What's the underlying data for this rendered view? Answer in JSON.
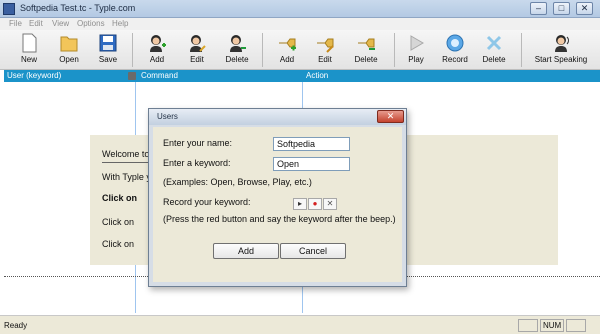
{
  "window": {
    "title": "Softpedia Test.tc - Typle.com",
    "minimize": "–",
    "maximize": "□",
    "close": "✕"
  },
  "menu": [
    "File",
    "Edit",
    "View",
    "Options",
    "Help"
  ],
  "toolbar": {
    "new": "New",
    "open": "Open",
    "save": "Save",
    "user_add": "Add",
    "user_edit": "Edit",
    "user_delete": "Delete",
    "cmd_add": "Add",
    "cmd_edit": "Edit",
    "cmd_delete": "Delete",
    "play": "Play",
    "record": "Record",
    "action_delete": "Delete",
    "start_speaking": "Start Speaking"
  },
  "columns": {
    "user": "User (keyword)",
    "command": "Command",
    "action": "Action"
  },
  "welcome": {
    "line1": "Welcome to",
    "line2": "With Typle y",
    "line3": "Click on",
    "line4": "Click on",
    "line5": "Click on"
  },
  "dialog": {
    "title": "Users",
    "close": "✕",
    "name_label": "Enter your name:",
    "name_value": "Softpedia",
    "keyword_label": "Enter a keyword:",
    "keyword_value": "Open",
    "examples": "(Examples: Open, Browse, Play, etc.)",
    "record_label": "Record your keyword:",
    "record_play": "▸",
    "record_rec": "●",
    "record_clear": "✕",
    "instructions": "(Press the red button and say the keyword after the beep.)",
    "add": "Add",
    "cancel": "Cancel"
  },
  "status": {
    "text": "Ready",
    "num": "NUM"
  },
  "colors": {
    "header": "#1b93c9",
    "dialog_bg": "#ece9d8",
    "record_red": "#d42020"
  }
}
